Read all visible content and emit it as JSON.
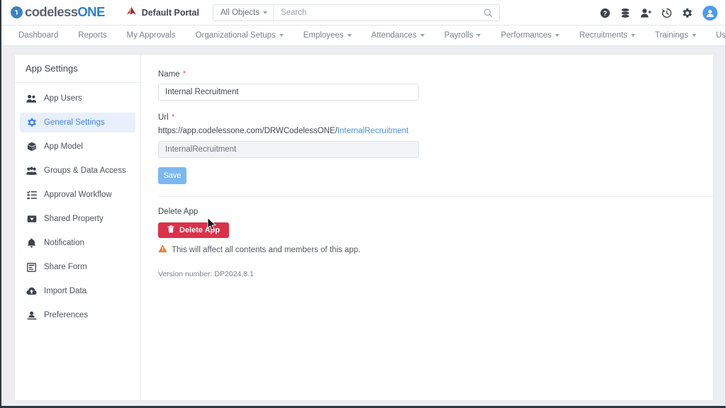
{
  "brand": {
    "logo_text_primary": "codeless",
    "logo_text_accent": "ONE",
    "logo_icon": "codeless-one-circle-icon",
    "accent_color": "#2b7fd4"
  },
  "topbar": {
    "portal_icon": "portal-mark-icon",
    "portal_label": "Default Portal",
    "search": {
      "scope_label": "All Objects",
      "scope_caret_icon": "caret-down-icon",
      "placeholder": "Search",
      "value": "",
      "search_icon": "search-icon"
    },
    "icons": [
      {
        "name": "help-icon",
        "title": "Help"
      },
      {
        "name": "database-icon",
        "title": "Data"
      },
      {
        "name": "add-user-icon",
        "title": "Add User"
      },
      {
        "name": "history-icon",
        "title": "History"
      },
      {
        "name": "gear-icon",
        "title": "Settings"
      },
      {
        "name": "avatar-icon",
        "title": "Account"
      }
    ]
  },
  "nav": {
    "items": [
      {
        "label": "Dashboard",
        "has_caret": false
      },
      {
        "label": "Reports",
        "has_caret": false
      },
      {
        "label": "My Approvals",
        "has_caret": false
      },
      {
        "label": "Organizational Setups",
        "has_caret": true
      },
      {
        "label": "Employees",
        "has_caret": true
      },
      {
        "label": "Attendances",
        "has_caret": true
      },
      {
        "label": "Payrolls",
        "has_caret": true
      },
      {
        "label": "Performances",
        "has_caret": true
      },
      {
        "label": "Recruitments",
        "has_caret": true
      },
      {
        "label": "Trainings",
        "has_caret": true
      },
      {
        "label": "User Profiles",
        "has_caret": true
      }
    ]
  },
  "sidebar": {
    "title": "App Settings",
    "items": [
      {
        "label": "App Users",
        "icon": "users-icon",
        "active": false
      },
      {
        "label": "General Settings",
        "icon": "gear-icon",
        "active": true
      },
      {
        "label": "App Model",
        "icon": "cube-icon",
        "active": false
      },
      {
        "label": "Groups & Data Access",
        "icon": "group-access-icon",
        "active": false
      },
      {
        "label": "Approval Workflow",
        "icon": "checklist-icon",
        "active": false
      },
      {
        "label": "Shared Property",
        "icon": "tag-icon",
        "active": false
      },
      {
        "label": "Notification",
        "icon": "bell-icon",
        "active": false
      },
      {
        "label": "Share Form",
        "icon": "form-icon",
        "active": false
      },
      {
        "label": "Import Data",
        "icon": "cloud-upload-icon",
        "active": false
      },
      {
        "label": "Preferences",
        "icon": "preferences-icon",
        "active": false
      }
    ],
    "active_bg": "#e8f0fd",
    "active_fg": "#4285f4"
  },
  "form": {
    "name_label": "Name",
    "name_required": "*",
    "name_value": "Internal Recruitment",
    "name_placeholder": "",
    "url_label": "Url",
    "url_required": "*",
    "url_base": "https://app.codelessone.com/DRWCodelessONE/",
    "url_slug": "InternalRecruitment",
    "url_input_value": "InternalRecruitment",
    "url_input_placeholder": "",
    "save_label": "Save",
    "save_color": "#7cb8f0"
  },
  "delete_section": {
    "section_title": "Delete App",
    "button_label": "Delete App",
    "button_icon": "trash-icon",
    "button_color": "#dc3149",
    "warning_icon": "warning-triangle-icon",
    "warning_text": "This will affect all contents and members of this app.",
    "version_text": "Version number: DP2024.8.1"
  },
  "cursor": {
    "icon": "mouse-pointer-icon"
  }
}
